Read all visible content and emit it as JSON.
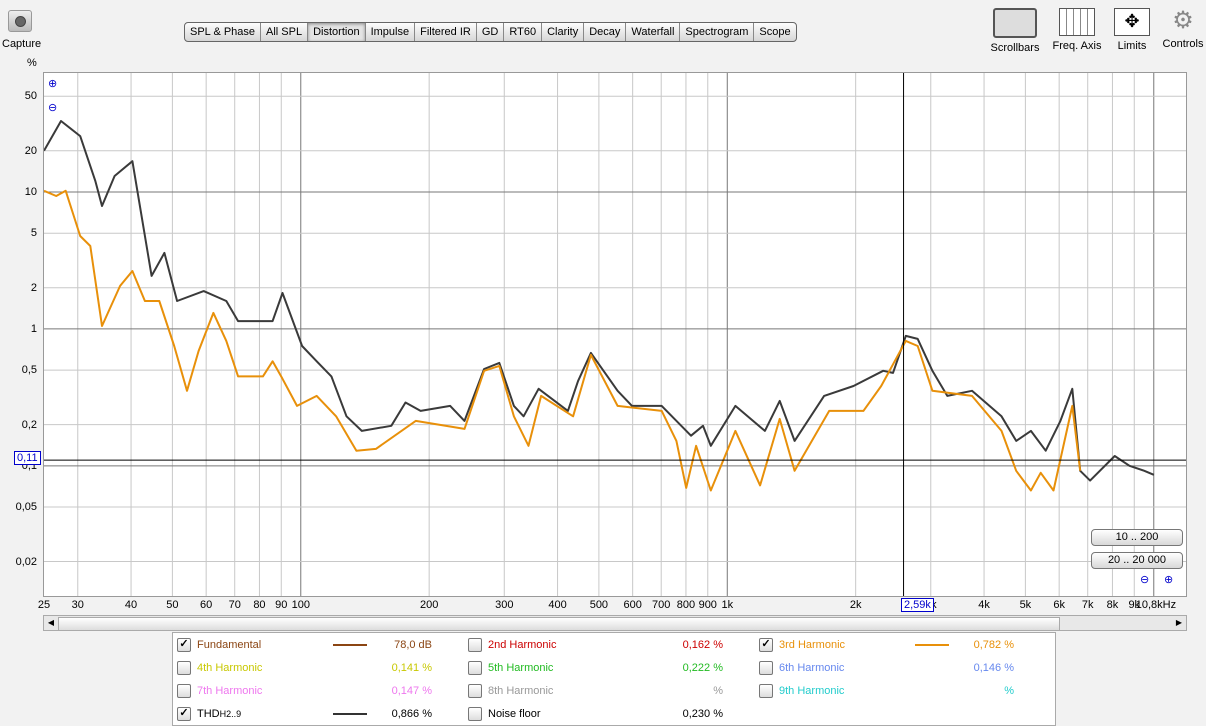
{
  "toolbar": {
    "capture": "Capture",
    "tabs": [
      "SPL & Phase",
      "All SPL",
      "Distortion",
      "Impulse",
      "Filtered IR",
      "GD",
      "RT60",
      "Clarity",
      "Decay",
      "Waterfall",
      "Spectrogram",
      "Scope"
    ],
    "active_tab": "Distortion",
    "scrollbars": "Scrollbars",
    "freq_axis": "Freq. Axis",
    "limits": "Limits",
    "controls": "Controls"
  },
  "buttons": {
    "range1": "10 .. 200",
    "range2": "20 .. 20 000"
  },
  "cursor": {
    "x_label": "2,59k",
    "y_label": "0,11",
    "x_value": 2590,
    "y_value": 0.11
  },
  "legend": [
    {
      "label": "Fundamental",
      "value": "78,0 dB",
      "checked": true,
      "color": "#8b4513",
      "line": true
    },
    {
      "label": "2nd Harmonic",
      "value": "0,162 %",
      "checked": false,
      "color": "#cc0000"
    },
    {
      "label": "3rd Harmonic",
      "value": "0,782 %",
      "checked": true,
      "color": "#e8900a",
      "line": true
    },
    {
      "label": "4th Harmonic",
      "value": "0,141 %",
      "checked": false,
      "color": "#c8c800"
    },
    {
      "label": "5th Harmonic",
      "value": "0,222 %",
      "checked": false,
      "color": "#22bb22"
    },
    {
      "label": "6th Harmonic",
      "value": "0,146 %",
      "checked": false,
      "color": "#6688ee"
    },
    {
      "label": "7th Harmonic",
      "value": "0,147 %",
      "checked": false,
      "color": "#ee77ee"
    },
    {
      "label": "8th Harmonic",
      "value": "%",
      "checked": false,
      "color": "#999999"
    },
    {
      "label": "9th Harmonic",
      "value": "%",
      "checked": false,
      "color": "#22cccc"
    },
    {
      "label": "THD",
      "sub": "H2..9",
      "value": "0,866 %",
      "checked": true,
      "color": "#333333",
      "line": true
    },
    {
      "label": "Noise floor",
      "value": "0,230 %",
      "checked": false,
      "color": "#333333"
    }
  ],
  "chart_data": {
    "type": "line",
    "ylabel": "%",
    "xlabel": "Hz",
    "xscale": "log",
    "yscale": "log",
    "xlim": [
      25,
      11900
    ],
    "ylim": [
      0.0112,
      74
    ],
    "xticks": [
      {
        "v": 25,
        "l": "25"
      },
      {
        "v": 30,
        "l": "30"
      },
      {
        "v": 40,
        "l": "40"
      },
      {
        "v": 50,
        "l": "50"
      },
      {
        "v": 60,
        "l": "60"
      },
      {
        "v": 70,
        "l": "70"
      },
      {
        "v": 80,
        "l": "80"
      },
      {
        "v": 90,
        "l": "90"
      },
      {
        "v": 100,
        "l": "100"
      },
      {
        "v": 200,
        "l": "200"
      },
      {
        "v": 300,
        "l": "300"
      },
      {
        "v": 400,
        "l": "400"
      },
      {
        "v": 500,
        "l": "500"
      },
      {
        "v": 600,
        "l": "600"
      },
      {
        "v": 700,
        "l": "700"
      },
      {
        "v": 800,
        "l": "800"
      },
      {
        "v": 900,
        "l": "900"
      },
      {
        "v": 1000,
        "l": "1k"
      },
      {
        "v": 2000,
        "l": "2k"
      },
      {
        "v": 3000,
        "l": "3k"
      },
      {
        "v": 4000,
        "l": "4k"
      },
      {
        "v": 5000,
        "l": "5k"
      },
      {
        "v": 6000,
        "l": "6k"
      },
      {
        "v": 7000,
        "l": "7k"
      },
      {
        "v": 8000,
        "l": "8k"
      },
      {
        "v": 9000,
        "l": "9k"
      },
      {
        "v": 10800,
        "l": "10,8kHz"
      }
    ],
    "yticks": [
      {
        "v": 50,
        "l": "50"
      },
      {
        "v": 20,
        "l": "20"
      },
      {
        "v": 10,
        "l": "10"
      },
      {
        "v": 5,
        "l": "5"
      },
      {
        "v": 2,
        "l": "2"
      },
      {
        "v": 1,
        "l": "1"
      },
      {
        "v": 0.5,
        "l": "0,5"
      },
      {
        "v": 0.2,
        "l": "0,2"
      },
      {
        "v": 0.1,
        "l": "0,1"
      },
      {
        "v": 0.05,
        "l": "0,05"
      },
      {
        "v": 0.02,
        "l": "0,02"
      }
    ],
    "series": [
      {
        "name": "THD",
        "color": "#3a3a3a",
        "points": [
          [
            25,
            20
          ],
          [
            27.4,
            33
          ],
          [
            30.4,
            25.6
          ],
          [
            33,
            12
          ],
          [
            34.2,
            7.9
          ],
          [
            36.6,
            13.1
          ],
          [
            40.3,
            16.8
          ],
          [
            44.7,
            2.44
          ],
          [
            47.9,
            3.59
          ],
          [
            51.3,
            1.6
          ],
          [
            59.2,
            1.89
          ],
          [
            66.9,
            1.6
          ],
          [
            71.3,
            1.14
          ],
          [
            85.9,
            1.14
          ],
          [
            90.6,
            1.83
          ],
          [
            100.7,
            0.75
          ],
          [
            109,
            0.58
          ],
          [
            118,
            0.45
          ],
          [
            128,
            0.23
          ],
          [
            139,
            0.18
          ],
          [
            163,
            0.196
          ],
          [
            176,
            0.29
          ],
          [
            191,
            0.252
          ],
          [
            224,
            0.274
          ],
          [
            242,
            0.213
          ],
          [
            269,
            0.51
          ],
          [
            292,
            0.565
          ],
          [
            316,
            0.274
          ],
          [
            333,
            0.23
          ],
          [
            361,
            0.365
          ],
          [
            423,
            0.252
          ],
          [
            447,
            0.417
          ],
          [
            479,
            0.668
          ],
          [
            553,
            0.353
          ],
          [
            598,
            0.274
          ],
          [
            702,
            0.274
          ],
          [
            822,
            0.166
          ],
          [
            877,
            0.196
          ],
          [
            915,
            0.14
          ],
          [
            1045,
            0.274
          ],
          [
            1225,
            0.18
          ],
          [
            1327,
            0.298
          ],
          [
            1438,
            0.152
          ],
          [
            1687,
            0.324
          ],
          [
            1977,
            0.383
          ],
          [
            2320,
            0.494
          ],
          [
            2447,
            0.477
          ],
          [
            2622,
            0.889
          ],
          [
            2795,
            0.845
          ],
          [
            3027,
            0.494
          ],
          [
            3280,
            0.324
          ],
          [
            3747,
            0.353
          ],
          [
            4394,
            0.23
          ],
          [
            4757,
            0.152
          ],
          [
            5151,
            0.18
          ],
          [
            5580,
            0.129
          ],
          [
            6040,
            0.213
          ],
          [
            6440,
            0.365
          ],
          [
            6720,
            0.092
          ],
          [
            7090,
            0.078
          ],
          [
            8100,
            0.118
          ],
          [
            8770,
            0.1
          ],
          [
            9500,
            0.092
          ],
          [
            10000,
            0.086
          ]
        ]
      },
      {
        "name": "3rd Harmonic",
        "color": "#e8900a",
        "points": [
          [
            25,
            10.2
          ],
          [
            26.7,
            9.35
          ],
          [
            28.1,
            10.2
          ],
          [
            30.4,
            4.77
          ],
          [
            32.1,
            4.03
          ],
          [
            34.2,
            1.05
          ],
          [
            37.7,
            2.06
          ],
          [
            40.3,
            2.65
          ],
          [
            43.1,
            1.6
          ],
          [
            46.6,
            1.6
          ],
          [
            50.5,
            0.75
          ],
          [
            54.1,
            0.353
          ],
          [
            57.6,
            0.69
          ],
          [
            62.4,
            1.31
          ],
          [
            66.9,
            0.817
          ],
          [
            71.3,
            0.45
          ],
          [
            81.5,
            0.45
          ],
          [
            85.9,
            0.58
          ],
          [
            90.6,
            0.432
          ],
          [
            98,
            0.274
          ],
          [
            109,
            0.324
          ],
          [
            121,
            0.23
          ],
          [
            135,
            0.129
          ],
          [
            150,
            0.133
          ],
          [
            186,
            0.213
          ],
          [
            242,
            0.186
          ],
          [
            269,
            0.494
          ],
          [
            292,
            0.537
          ],
          [
            316,
            0.23
          ],
          [
            342,
            0.14
          ],
          [
            366,
            0.324
          ],
          [
            435,
            0.23
          ],
          [
            479,
            0.646
          ],
          [
            553,
            0.274
          ],
          [
            702,
            0.252
          ],
          [
            760,
            0.152
          ],
          [
            801,
            0.069
          ],
          [
            845,
            0.14
          ],
          [
            915,
            0.066
          ],
          [
            1045,
            0.18
          ],
          [
            1194,
            0.072
          ],
          [
            1327,
            0.22
          ],
          [
            1438,
            0.092
          ],
          [
            1734,
            0.252
          ],
          [
            2085,
            0.252
          ],
          [
            2296,
            0.383
          ],
          [
            2622,
            0.817
          ],
          [
            2795,
            0.75
          ],
          [
            3027,
            0.353
          ],
          [
            3747,
            0.324
          ],
          [
            4394,
            0.18
          ],
          [
            4757,
            0.092
          ],
          [
            5151,
            0.066
          ],
          [
            5430,
            0.089
          ],
          [
            5820,
            0.066
          ],
          [
            6440,
            0.274
          ],
          [
            6720,
            0.092
          ]
        ]
      }
    ]
  }
}
